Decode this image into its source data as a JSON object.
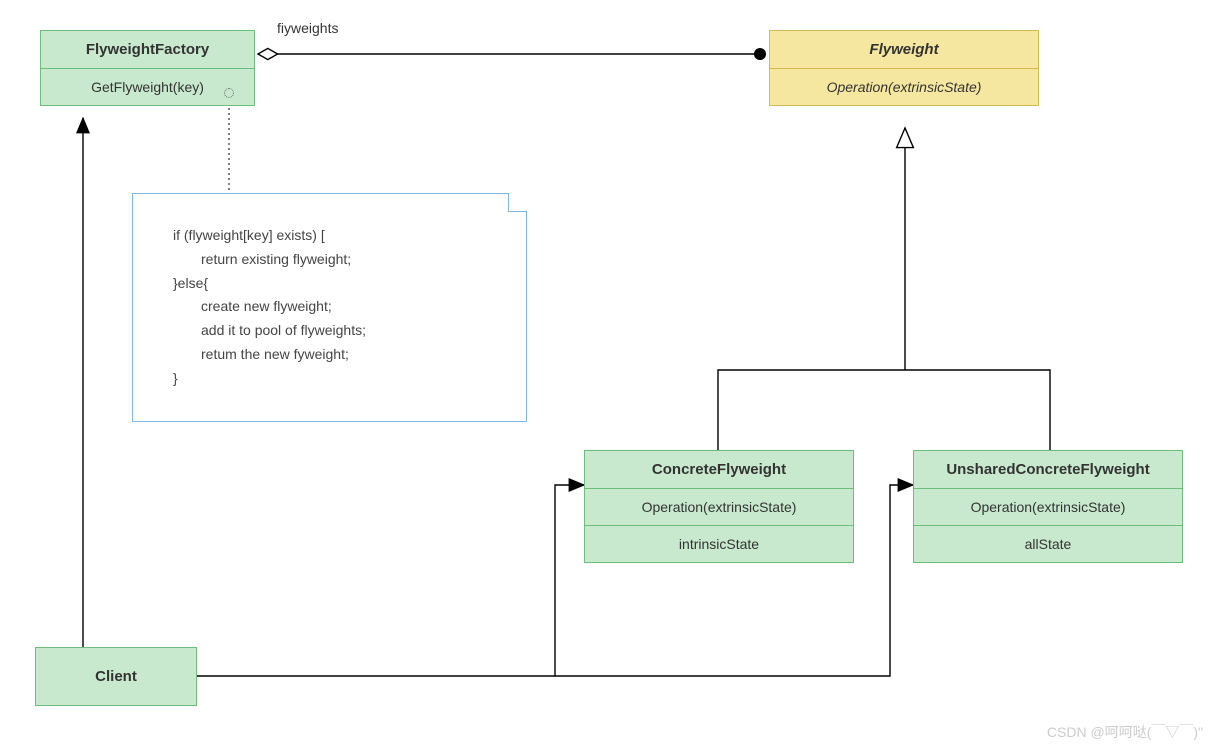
{
  "factory": {
    "title": "FlyweightFactory",
    "method": "GetFlyweight(key)"
  },
  "flyweight": {
    "title": "Flyweight",
    "method": "Operation(extrinsicState)"
  },
  "concrete": {
    "title": "ConcreteFlyweight",
    "method": "Operation(extrinsicState)",
    "state": "intrinsicState"
  },
  "unshared": {
    "title": "UnsharedConcreteFlyweight",
    "method": "Operation(extrinsicState)",
    "state": "allState"
  },
  "client": {
    "title": "Client"
  },
  "assoc_label": "fiyweights",
  "note": {
    "line1": "if (flyweight[key] exists) [",
    "line2": "return existing flyweight;",
    "line3": "}else{",
    "line4": "create new flyweight;",
    "line5": "add it to pool of flyweights;",
    "line6": "retum the new fyweight;",
    "line7": "}"
  },
  "watermark": "CSDN @呵呵哒(￣▽￣)\""
}
